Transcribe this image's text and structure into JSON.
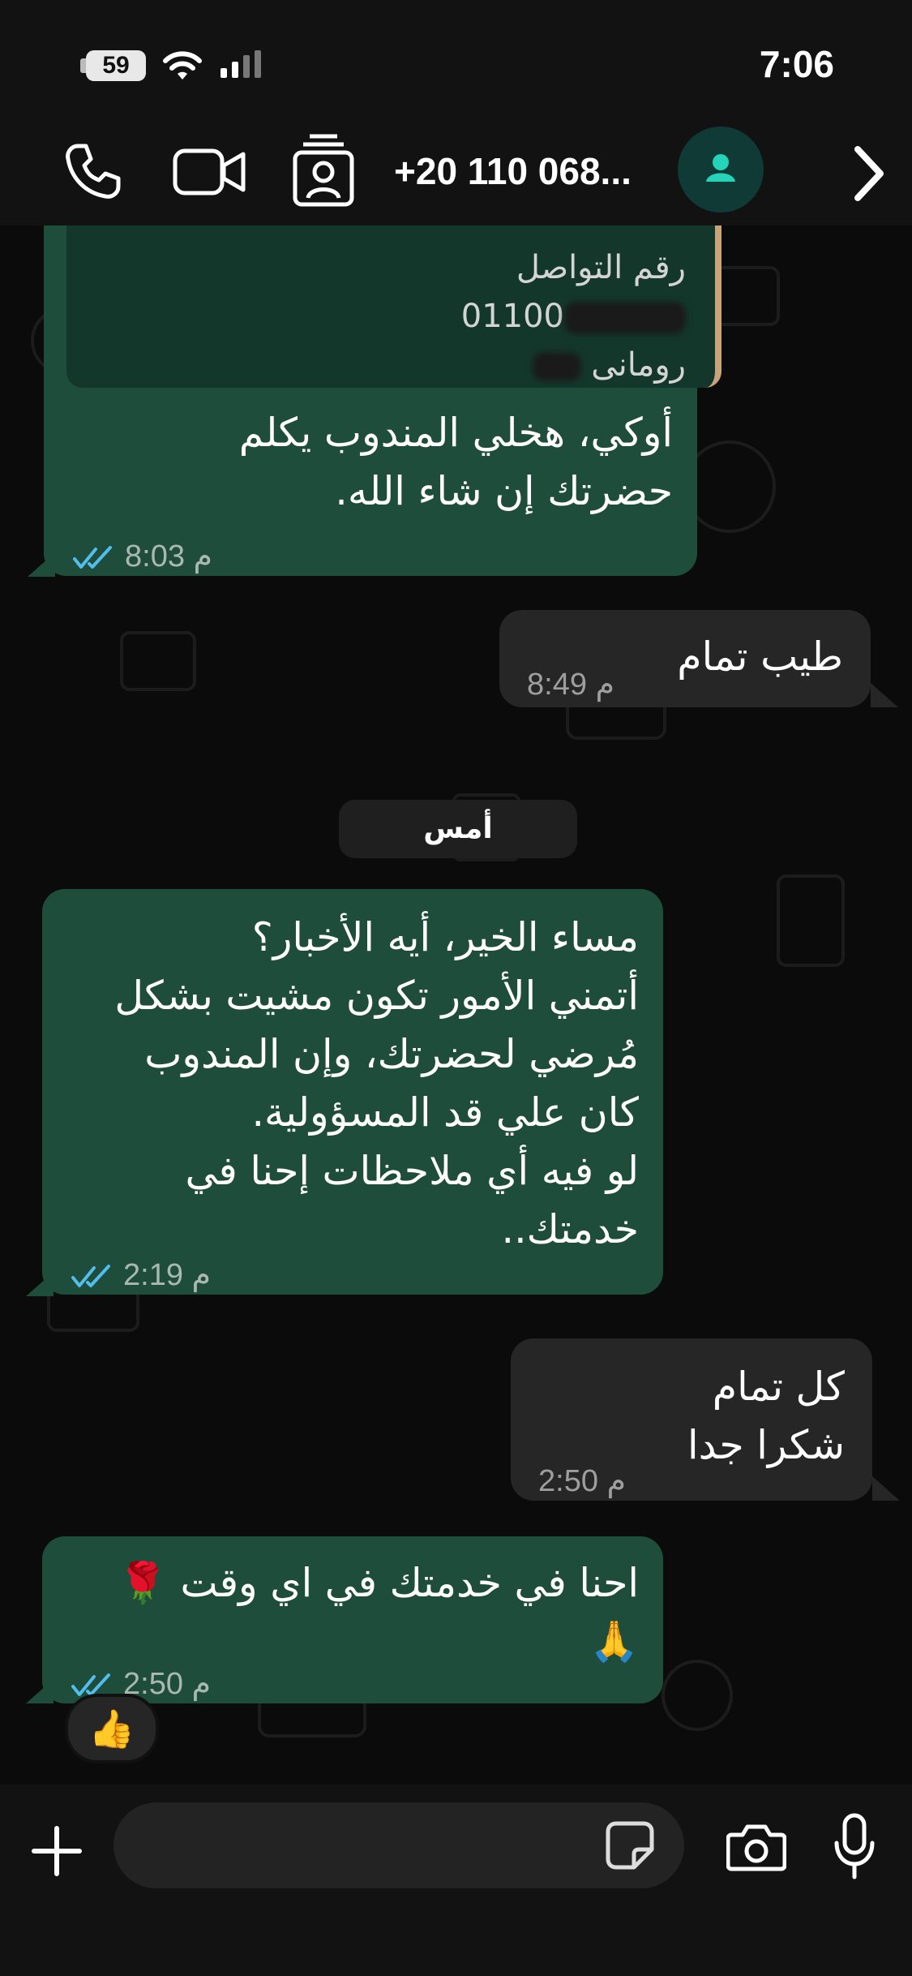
{
  "status_bar": {
    "time": "7:06",
    "battery": "59"
  },
  "header": {
    "contact_name": "+20 110 068..."
  },
  "chat": {
    "quote": {
      "line1": "رقم التواصل",
      "number_prefix": "01100",
      "name_prefix": "رومانى"
    },
    "messages": [
      {
        "id": "m1",
        "dir": "out",
        "lines": [
          "أوكي، هخلي المندوب يكلم",
          "حضرتك إن شاء الله."
        ],
        "time": "8:03 م"
      },
      {
        "id": "m2",
        "dir": "in",
        "lines": [
          "طيب تمام"
        ],
        "time": "8:49 م"
      },
      {
        "id": "m3",
        "dir": "out",
        "lines": [
          "مساء الخير، أيه الأخبار؟",
          "أتمني الأمور تكون مشيت بشكل",
          "مُرضي لحضرتك، وإن المندوب",
          "كان علي قد المسؤولية.",
          "لو فيه أي ملاحظات إحنا في",
          "خدمتك.."
        ],
        "time": "2:19 م"
      },
      {
        "id": "m4",
        "dir": "in",
        "lines": [
          "كل تمام",
          "شكرا جدا"
        ],
        "time": "2:50 م"
      },
      {
        "id": "m5",
        "dir": "out",
        "lines": [
          "احنا في خدمتك في اي وقت 🌹",
          "🙏"
        ],
        "time": "2:50 م"
      }
    ],
    "date_separator": "أمس",
    "reaction": "👍"
  },
  "composer": {
    "placeholder": ""
  },
  "colors": {
    "outgoing_bubble": "#1e4d3c",
    "incoming_bubble": "#262626",
    "read_ticks": "#53bdeb",
    "avatar_accent": "#25d3b8"
  }
}
